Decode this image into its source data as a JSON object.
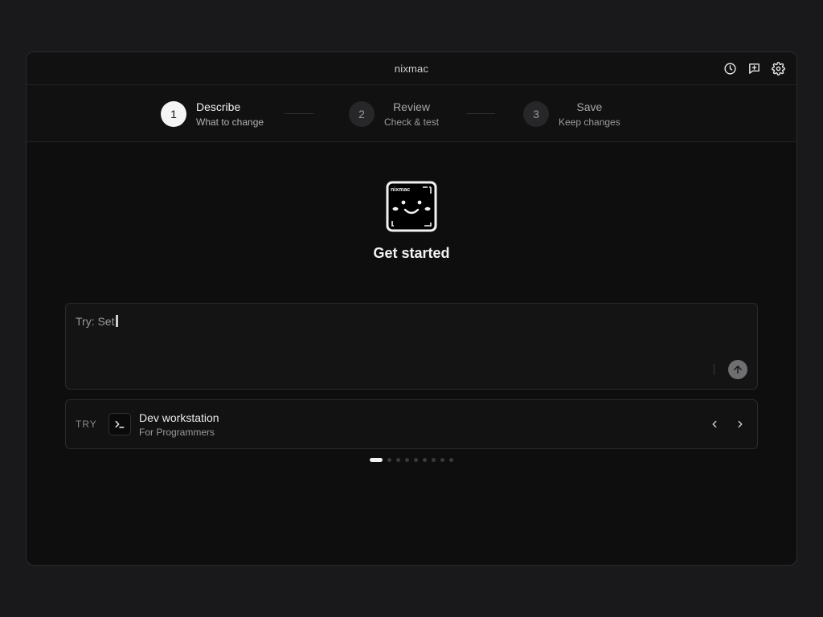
{
  "window": {
    "title": "nixmac"
  },
  "titlebar": {
    "actions": [
      {
        "icon": "history-icon"
      },
      {
        "icon": "feedback-icon"
      },
      {
        "icon": "gear-icon"
      }
    ]
  },
  "steps": [
    {
      "number": "1",
      "title": "Describe",
      "subtitle": "What to change",
      "active": true
    },
    {
      "number": "2",
      "title": "Review",
      "subtitle": "Check & test",
      "active": false
    },
    {
      "number": "3",
      "title": "Save",
      "subtitle": "Keep changes",
      "active": false
    }
  ],
  "hero": {
    "logo_text": "nixmac",
    "title": "Get started"
  },
  "prompt": {
    "value": "Try: Set"
  },
  "suggestion": {
    "label": "TRY",
    "icon": "terminal-icon",
    "title": "Dev workstation",
    "subtitle": "For Programmers"
  },
  "carousel": {
    "count": 9,
    "active_index": 0
  },
  "colors": {
    "background": "#19191b",
    "window": "#0e0e0e",
    "active_step": "#f5f5f5"
  }
}
